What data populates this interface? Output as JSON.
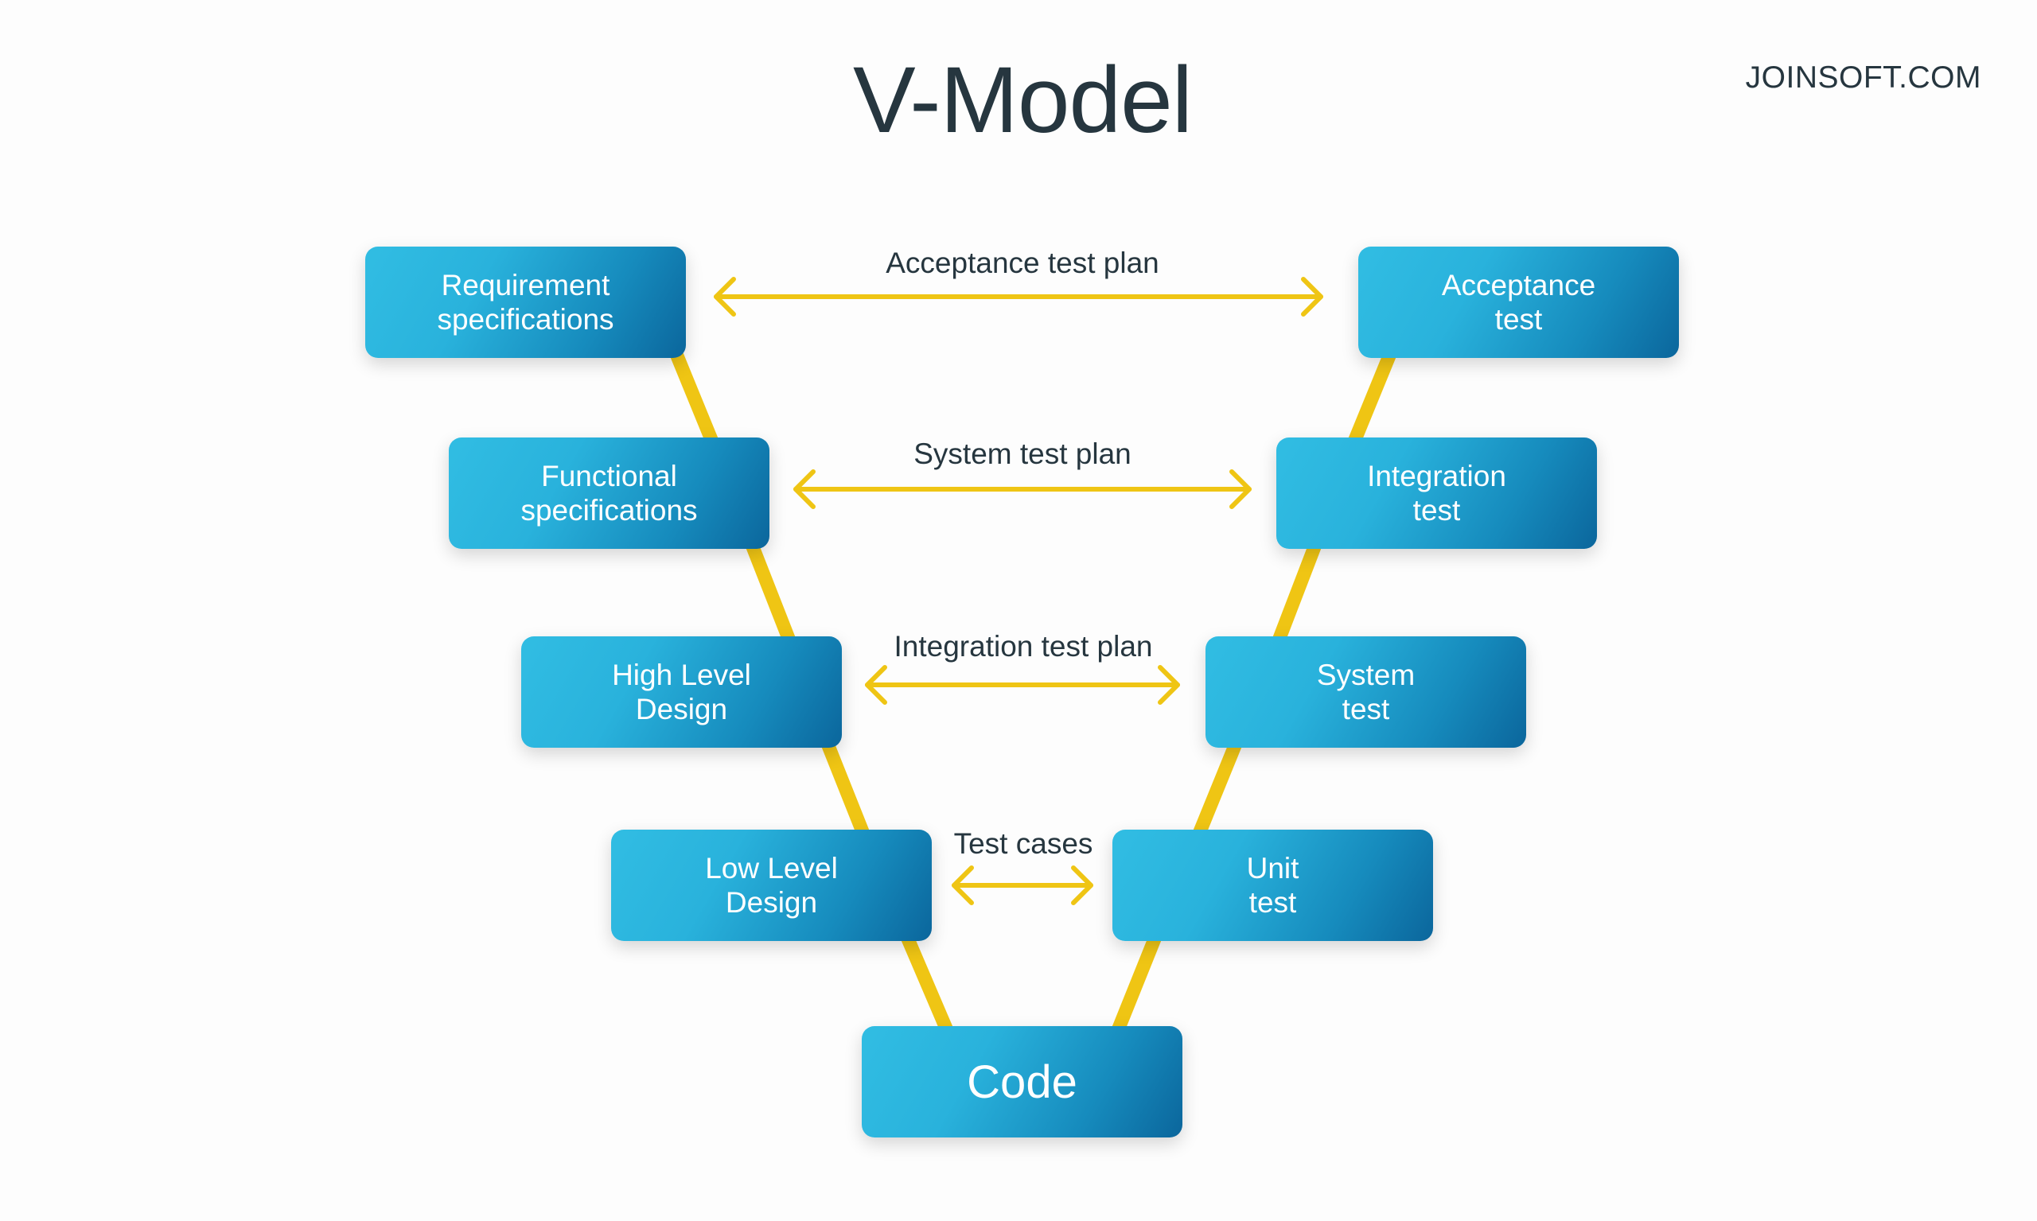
{
  "title": "V-Model",
  "brand": "JOINSOFT.COM",
  "colors": {
    "box_gradient_start": "#31bde3",
    "box_gradient_end": "#0b669c",
    "connector": "#efc514",
    "text_dark": "#26363f",
    "box_text": "#ffffff"
  },
  "left_phases": [
    {
      "label": "Requirement\nspecifications"
    },
    {
      "label": "Functional\nspecifications"
    },
    {
      "label": "High Level\nDesign"
    },
    {
      "label": "Low Level\nDesign"
    }
  ],
  "right_phases": [
    {
      "label": "Acceptance\ntest"
    },
    {
      "label": "Integration\ntest"
    },
    {
      "label": "System\ntest"
    },
    {
      "label": "Unit\ntest"
    }
  ],
  "bottom": {
    "label": "Code"
  },
  "links": [
    {
      "label": "Acceptance test plan",
      "from": "Requirement specifications",
      "to": "Acceptance test"
    },
    {
      "label": "System test plan",
      "from": "Functional specifications",
      "to": "Integration test"
    },
    {
      "label": "Integration test plan",
      "from": "High Level Design",
      "to": "System test"
    },
    {
      "label": "Test cases",
      "from": "Low Level Design",
      "to": "Unit test"
    }
  ]
}
